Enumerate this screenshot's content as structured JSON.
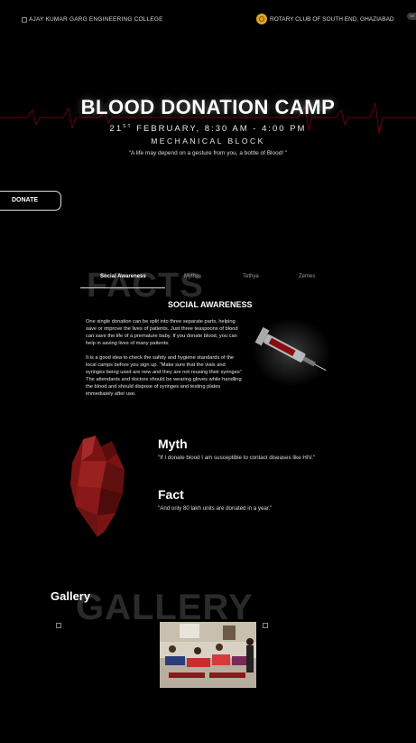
{
  "header": {
    "college": "AJAY KUMAR GARG ENGINEERING COLLEGE",
    "rotary": "ROTARY CLUB OF SOUTH END, GHAZIABAD",
    "nav_pill": "NE"
  },
  "hero": {
    "title": "BLOOD DONATION CAMP",
    "date_day": "21",
    "date_suffix": "ST",
    "date_rest": " FEBRUARY, 8:30 AM - 4:00 PM",
    "venue": "MECHANICAL BLOCK",
    "quote": "\"A life may depend on a gesture from you, a bottle of Blood! \""
  },
  "donate_button": "DONATE",
  "facts": {
    "bg_word": "FACTS",
    "tabs": [
      "Social Awareness",
      "Mythss",
      "Tethya",
      "Zemes"
    ],
    "active_tab": 0,
    "title": "SOCIAL AWARENESS",
    "para1": "One single donation can be split into three separate parts, helping save or improve the lives of patients. Just three teaspoons of blood can save the life of a premature baby. If you donate blood, you can help in saving lives of many patients.",
    "para2": "It is a good idea to check the safety and hygiene standards of the local camps before you sign up. \"Make sure that the vials and syringes being used are new and they are not reusing their syringes\" The attendants and doctors should be wearing gloves while handling the blood and should dispose of syringes and testing plates immediately after use."
  },
  "myth": {
    "heading": "Myth",
    "text": "\"If I donate blood I am susceptible to contact diseases like HIV.\""
  },
  "fact": {
    "heading": "Fact",
    "text": "\"And only 80 lakh units are donated in a year.\""
  },
  "gallery": {
    "bg_word": "GALLERY",
    "heading": "Gallery"
  },
  "colors": {
    "background": "#000000",
    "ecg_line": "#8b0000",
    "rotary_gold": "#e0a528"
  }
}
